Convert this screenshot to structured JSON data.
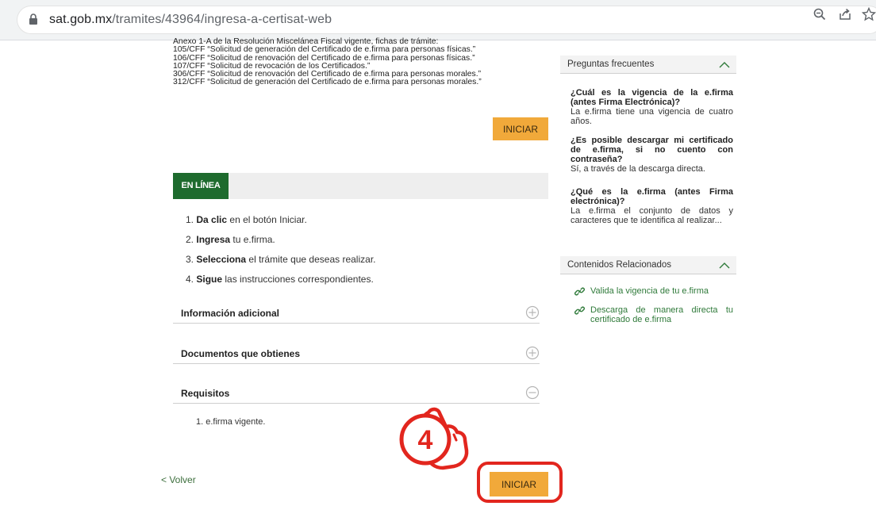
{
  "browser": {
    "url_host": "sat.gob.mx",
    "url_path": "/tramites/43964/ingresa-a-certisat-web"
  },
  "anexo": {
    "lines": [
      "Anexo 1-A de la Resolución Miscelánea Fiscal vigente, fichas de trámite:",
      "105/CFF “Solicitud de generación del Certificado de e.firma para personas físicas.”",
      "106/CFF “Solicitud de renovación del Certificado de e.firma para personas físicas.”",
      "107/CFF “Solicitud de revocación de los Certificados.”",
      "306/CFF “Solicitud de renovación del Certificado de e.firma para personas morales.”",
      "312/CFF “Solicitud de generación del Certificado de e.firma para personas morales.”"
    ]
  },
  "buttons": {
    "iniciar_top": "INICIAR",
    "iniciar_bottom": "INICIAR"
  },
  "tab": {
    "label": "EN LÍNEA"
  },
  "steps": [
    {
      "num": "1.",
      "bold": "Da clic",
      "rest": " en el botón Iniciar."
    },
    {
      "num": "2.",
      "bold": "Ingresa",
      "rest": "  tu e.firma."
    },
    {
      "num": "3.",
      "bold": "Selecciona",
      "rest": " el trámite que deseas realizar."
    },
    {
      "num": "4.",
      "bold": "Sigue",
      "rest": "  las instrucciones correspondientes."
    }
  ],
  "accordions": {
    "info": "Información adicional",
    "docs": "Documentos que obtienes",
    "req": "Requisitos"
  },
  "requisitos": {
    "item1": "1. e.firma vigente."
  },
  "volver": "< Volver",
  "badge": {
    "number": "4"
  },
  "faq_panel": {
    "title": "Preguntas frecuentes",
    "items": [
      {
        "q": "¿Cuál es la vigencia de la e.firma (antes Firma Electrónica)?",
        "a": "La e.firma tiene una vigencia de cuatro años."
      },
      {
        "q": "¿Es posible descargar mi certificado de e.firma, si no cuento con contraseña?",
        "a": "Sí, a través de la descarga directa."
      },
      {
        "q": "¿Qué es la e.firma (antes Firma electrónica)?",
        "a": "La e.firma el conjunto de datos y caracteres que te identifica al realizar..."
      }
    ]
  },
  "related_panel": {
    "title": "Contenidos Relacionados",
    "links": [
      "Valida la vigencia de tu e.firma",
      "Descarga de manera directa tu certificado de e.firma"
    ]
  },
  "colors": {
    "accent_orange": "#f1a93a",
    "tab_green": "#1e6b2e",
    "link_green": "#2f7a3a",
    "highlight_red": "#e2261e"
  }
}
